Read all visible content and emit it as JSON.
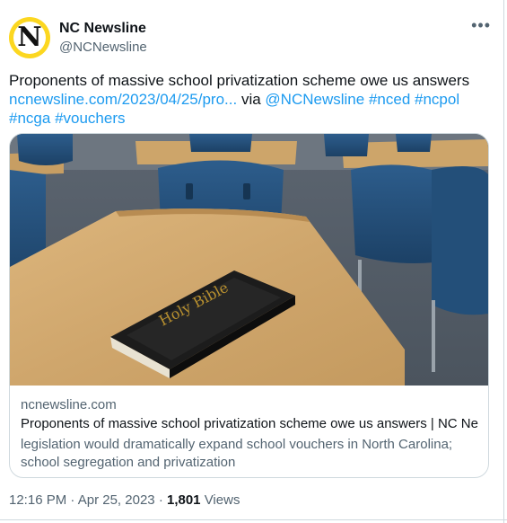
{
  "account": {
    "name": "NC Newsline",
    "handle": "@NCNewsline",
    "avatar_letter": "N",
    "avatar_color": "#fcd720"
  },
  "more_icon": "more-horizontal-icon",
  "tweet": {
    "text": "Proponents of massive school privatization scheme owe us answers",
    "url": "ncnewsline.com/2023/04/25/pro...",
    "via": "via",
    "mention": "@NCNewsline",
    "hashtags": [
      "#nced",
      "#ncpol",
      "#ncga",
      "#vouchers"
    ],
    "link_color": "#1d9bf0"
  },
  "card": {
    "image_book_text": "Holy Bible",
    "domain": "ncnewsline.com",
    "title": "Proponents of massive school privatization scheme owe us answers | NC Ne...",
    "description": "legislation would dramatically expand school vouchers in North Carolina; school segregation and privatization"
  },
  "meta": {
    "time": "12:16 PM",
    "sep1": "·",
    "date": "Apr 25, 2023",
    "sep2": "·",
    "views_count": "1,801",
    "views_label": "Views"
  }
}
